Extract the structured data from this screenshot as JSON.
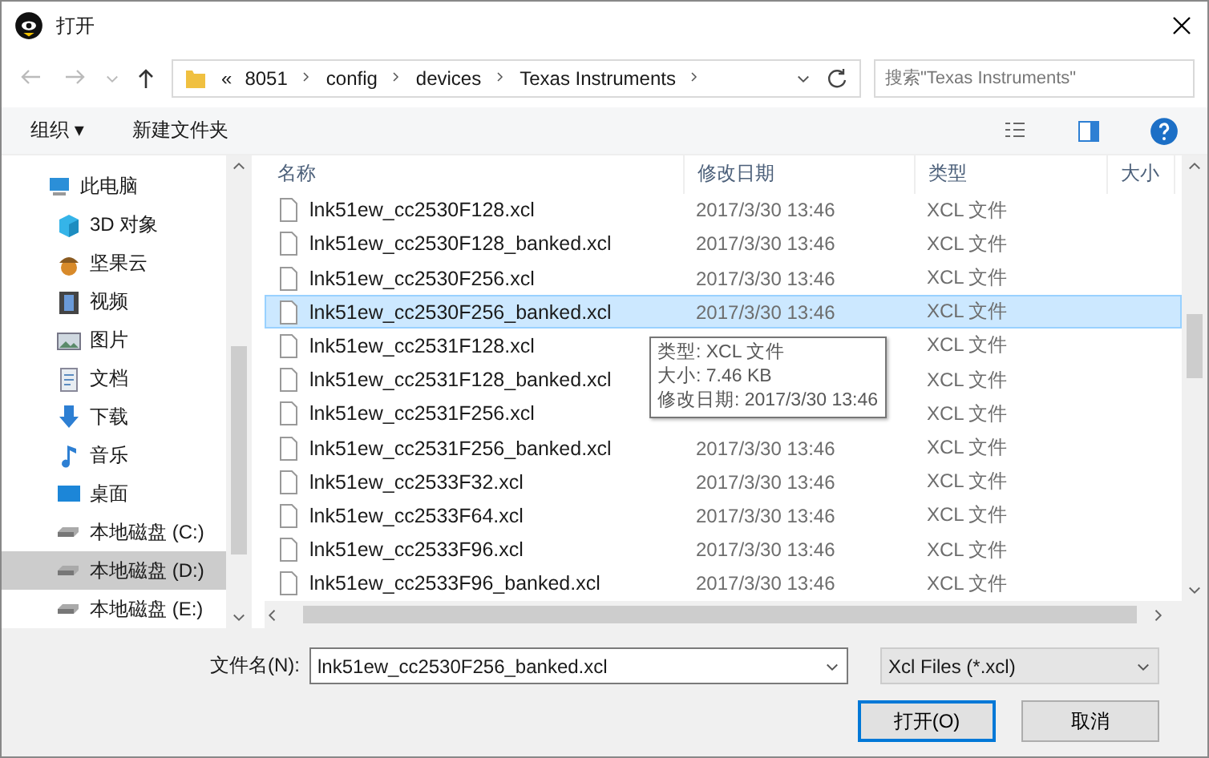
{
  "window": {
    "title": "打开"
  },
  "address_bar": {
    "overflow": "«",
    "segments": [
      "8051",
      "config",
      "devices",
      "Texas Instruments"
    ]
  },
  "search": {
    "placeholder": "搜索\"Texas Instruments\""
  },
  "toolbar": {
    "organize": "组织 ▾",
    "new_folder": "新建文件夹"
  },
  "sidebar": {
    "items": [
      {
        "label": "此电脑",
        "kind": "pc",
        "selected": false,
        "children": [
          {
            "label": "3D 对象",
            "kind": "cube",
            "selected": false
          },
          {
            "label": "坚果云",
            "kind": "nut",
            "selected": false
          },
          {
            "label": "视频",
            "kind": "video",
            "selected": false
          },
          {
            "label": "图片",
            "kind": "picture",
            "selected": false
          },
          {
            "label": "文档",
            "kind": "doc",
            "selected": false
          },
          {
            "label": "下载",
            "kind": "download",
            "selected": false
          },
          {
            "label": "音乐",
            "kind": "music",
            "selected": false
          },
          {
            "label": "桌面",
            "kind": "desktop",
            "selected": false
          },
          {
            "label": "本地磁盘 (C:)",
            "kind": "drive",
            "selected": false
          },
          {
            "label": "本地磁盘 (D:)",
            "kind": "drive",
            "selected": true
          },
          {
            "label": "本地磁盘 (E:)",
            "kind": "drive",
            "selected": false
          }
        ]
      }
    ]
  },
  "table": {
    "columns": [
      "名称",
      "修改日期",
      "类型",
      "大小"
    ],
    "rows": [
      {
        "name": "lnk51ew_cc2530F128.xcl",
        "date": "2017/3/30 13:46",
        "type": "XCL 文件",
        "selected": false
      },
      {
        "name": "lnk51ew_cc2530F128_banked.xcl",
        "date": "2017/3/30 13:46",
        "type": "XCL 文件",
        "selected": false
      },
      {
        "name": "lnk51ew_cc2530F256.xcl",
        "date": "2017/3/30 13:46",
        "type": "XCL 文件",
        "selected": false
      },
      {
        "name": "lnk51ew_cc2530F256_banked.xcl",
        "date": "2017/3/30 13:46",
        "type": "XCL 文件",
        "selected": true
      },
      {
        "name": "lnk51ew_cc2531F128.xcl",
        "type": "XCL 文件",
        "selected": false
      },
      {
        "name": "lnk51ew_cc2531F128_banked.xcl",
        "type": "XCL 文件",
        "selected": false
      },
      {
        "name": "lnk51ew_cc2531F256.xcl",
        "type": "XCL 文件",
        "selected": false
      },
      {
        "name": "lnk51ew_cc2531F256_banked.xcl",
        "date": "2017/3/30 13:46",
        "type": "XCL 文件",
        "selected": false
      },
      {
        "name": "lnk51ew_cc2533F32.xcl",
        "date": "2017/3/30 13:46",
        "type": "XCL 文件",
        "selected": false
      },
      {
        "name": "lnk51ew_cc2533F64.xcl",
        "date": "2017/3/30 13:46",
        "type": "XCL 文件",
        "selected": false
      },
      {
        "name": "lnk51ew_cc2533F96.xcl",
        "date": "2017/3/30 13:46",
        "type": "XCL 文件",
        "selected": false
      },
      {
        "name": "lnk51ew_cc2533F96_banked.xcl",
        "date": "2017/3/30 13:46",
        "type": "XCL 文件",
        "selected": false
      }
    ]
  },
  "tooltip": {
    "lines": [
      "类型: XCL 文件",
      "大小: 7.46 KB",
      "修改日期: 2017/3/30 13:46"
    ]
  },
  "file_name": {
    "label": "文件名(N):",
    "value": "lnk51ew_cc2530F256_banked.xcl"
  },
  "file_type": {
    "value": "Xcl Files (*.xcl)"
  },
  "buttons": [
    {
      "label": "打开(O)",
      "kind": "primary"
    },
    {
      "label": "取消",
      "kind": "normal"
    }
  ]
}
